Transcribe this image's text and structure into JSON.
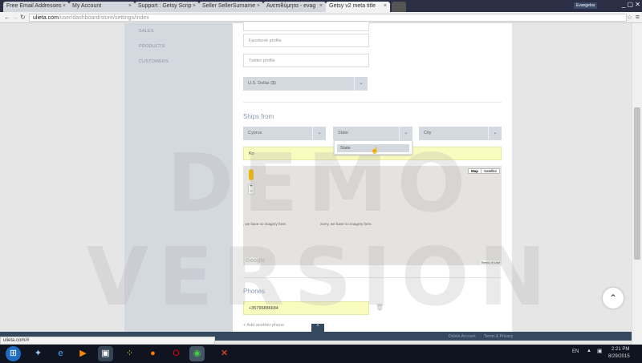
{
  "browser": {
    "tabs": [
      {
        "label": "Free Email Addresses"
      },
      {
        "label": "My Account"
      },
      {
        "label": "Support : Getsy Scrip"
      },
      {
        "label": "Seller SellerSurname"
      },
      {
        "label": "Ανεπιθύμητα - evag"
      },
      {
        "label": "Getsy v2 meta title"
      }
    ],
    "profile_badge": "Evangelos",
    "url_domain": "ulieta.com",
    "url_path": "/user/dashboard/store/settings/index",
    "status_url": "ulieta.com/#"
  },
  "sidebar": {
    "items": [
      {
        "label": "SALES"
      },
      {
        "label": "PRODUCTS"
      },
      {
        "label": "CUSTOMERS"
      }
    ]
  },
  "form": {
    "facebook_placeholder": "Facebook profile",
    "twitter_placeholder": "Twitter profile",
    "currency": "U.S. Dollar ($)",
    "ships_from_heading": "Ships from",
    "country": "Cyprus",
    "state": "State",
    "city": "City",
    "state_option": "State",
    "location_value": "Ko",
    "map": {
      "no_imagery_left": ", we have no imagery here.",
      "no_imagery": "Sorry, we have no imagery here.",
      "map_btn": "Map",
      "satellite_btn": "Satellite",
      "google": "Google",
      "terms": "Terms of Use",
      "zoom_in": "+",
      "zoom_out": "−"
    },
    "phones_heading": "Phones",
    "phone_value": "+35796886684",
    "add_phone": "+ Add another phone"
  },
  "watermark": "DEMO VERSION",
  "footer": {
    "delete_account": "Delete Account",
    "terms": "Terms & Privacy"
  },
  "taskbar": {
    "lang": "EN",
    "time": "2:21 PM",
    "date": "8/29/2015"
  }
}
